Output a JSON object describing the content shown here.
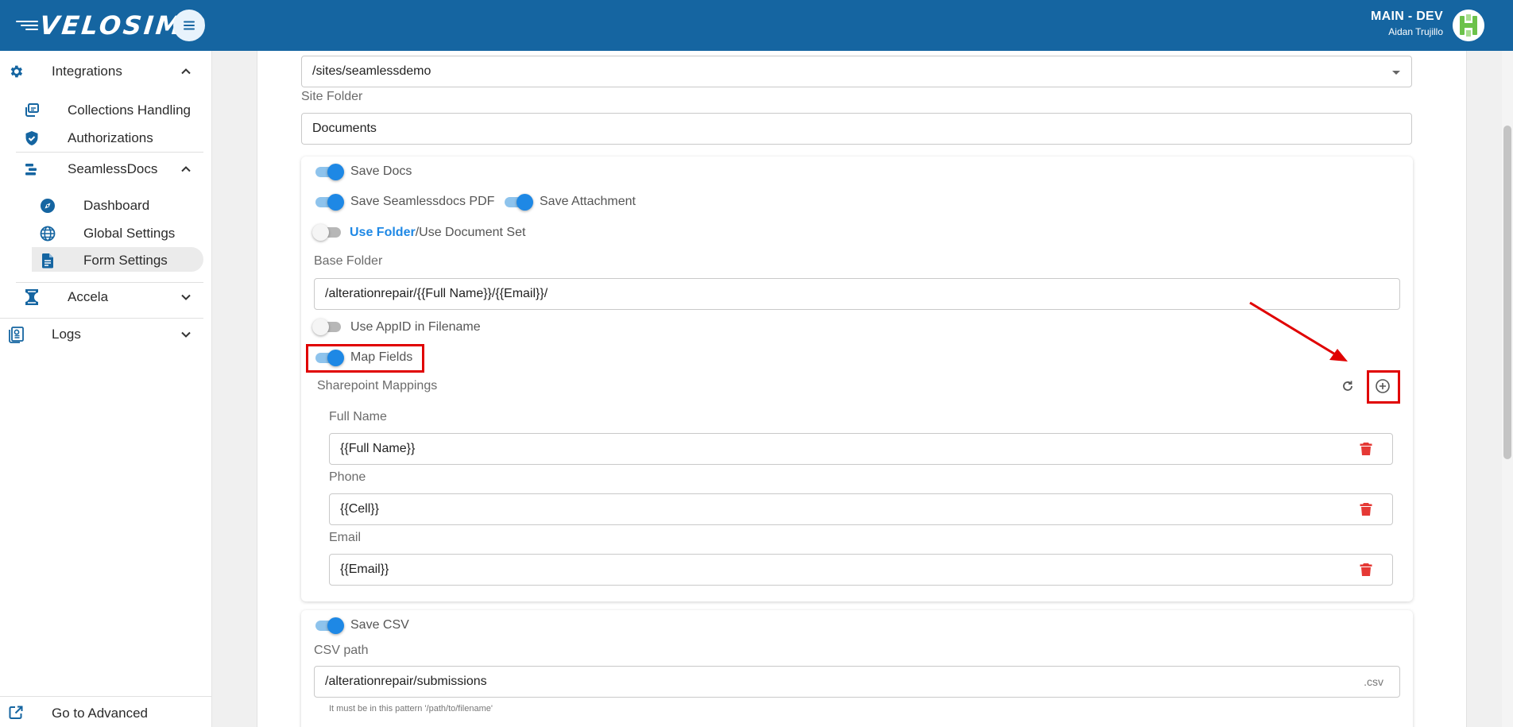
{
  "app": {
    "logo_text": "VELOSIMO",
    "environment": "MAIN - DEV",
    "user_name": "Aidan Trujillo",
    "brand_color": "#1565a1",
    "accent_color": "#1e88e5"
  },
  "sidebar": {
    "integrations": {
      "label": "Integrations",
      "icon": "gear-icon",
      "expanded": true
    },
    "collections_handling": {
      "label": "Collections Handling",
      "icon": "collections-icon"
    },
    "authorizations": {
      "label": "Authorizations",
      "icon": "shield-check-icon"
    },
    "seamlessdocs": {
      "label": "SeamlessDocs",
      "icon": "seamlessdocs-icon",
      "expanded": true
    },
    "dashboard": {
      "label": "Dashboard",
      "icon": "compass-icon"
    },
    "global_settings": {
      "label": "Global Settings",
      "icon": "globe-icon"
    },
    "form_settings": {
      "label": "Form Settings",
      "icon": "document-icon",
      "active": true
    },
    "accela": {
      "label": "Accela",
      "icon": "accela-icon",
      "expanded": false
    },
    "logs": {
      "label": "Logs",
      "icon": "logs-icon",
      "expanded": false
    },
    "go_advanced": {
      "label": "Go to Advanced",
      "icon": "external-link-icon"
    }
  },
  "form": {
    "site_path_value": "/sites/seamlessdemo",
    "site_folder_label": "Site Folder",
    "site_folder_value": "Documents",
    "save_docs_label": "Save Docs",
    "save_docs_on": true,
    "save_pdf_label": "Save Seamlessdocs PDF",
    "save_pdf_on": true,
    "save_attachment_label": "Save Attachment",
    "save_attachment_on": true,
    "use_folder_label": "Use Folder",
    "use_docset_label": "/Use Document Set",
    "use_folder_on": false,
    "base_folder_label": "Base Folder",
    "base_folder_value": "/alterationrepair/{{Full Name}}/{{Email}}/",
    "use_appid_label": "Use AppID in Filename",
    "use_appid_on": false,
    "map_fields_label": "Map Fields",
    "map_fields_on": true,
    "sharepoint_mappings_label": "Sharepoint Mappings",
    "mappings": [
      {
        "label": "Full Name",
        "value": "{{Full Name}}"
      },
      {
        "label": "Phone",
        "value": "{{Cell}}"
      },
      {
        "label": "Email",
        "value": "{{Email}}"
      }
    ],
    "save_csv_label": "Save CSV",
    "save_csv_on": true,
    "csv_path_label": "CSV path",
    "csv_path_value": "/alterationrepair/submissions",
    "csv_suffix": ".csv",
    "csv_hint": "It must be in this pattern '/path/to/filename'"
  }
}
